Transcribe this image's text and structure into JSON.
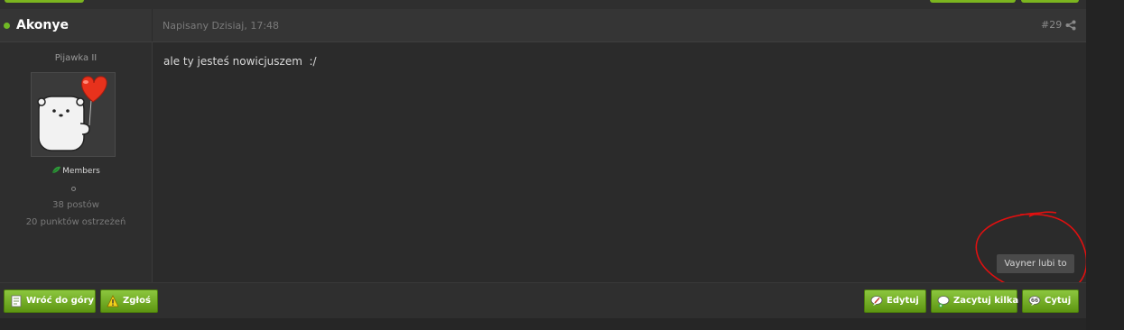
{
  "post": {
    "author": "Akonye",
    "date": "Napisany Dzisiaj, 17:48",
    "number": "#29",
    "body": "ale ty jesteś nowicjuszem  :/",
    "like_tooltip": "Vayner lubi to"
  },
  "author_info": {
    "title": "Pijawka II",
    "group": "Members",
    "post_count": "38 postów",
    "warning_points": "20 punktów ostrzeżeń"
  },
  "footer": {
    "back_to_top": "Wróć do góry",
    "report": "Zgłoś",
    "edit": "Edytuj",
    "multi_quote": "Zacytuj kilka",
    "quote": "Cytuj"
  },
  "colors": {
    "button_green": "#6fa91c",
    "online": "#6fb825",
    "annotation_red": "#e01010"
  },
  "icons": [
    "share-icon",
    "online-dot",
    "group-leaf-icon",
    "page-icon",
    "warning-icon",
    "edit-icon",
    "multi-quote-icon",
    "quote-icon"
  ]
}
